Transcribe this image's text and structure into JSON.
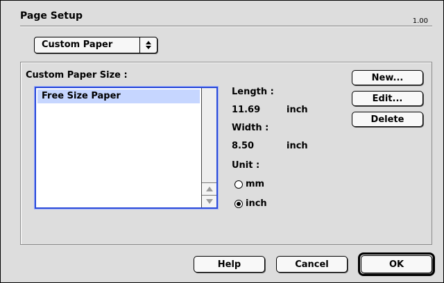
{
  "window": {
    "title": "Page Setup",
    "version": "1.00"
  },
  "popup": {
    "selected": "Custom Paper"
  },
  "custom_paper": {
    "group_label": "Custom Paper Size :",
    "list_items": [
      "Free Size Paper"
    ],
    "length_label": "Length :",
    "length_value": "11.69",
    "length_unit": "inch",
    "width_label": "Width :",
    "width_value": "8.50",
    "width_unit": "inch",
    "unit_label": "Unit :",
    "unit_options": [
      {
        "label": "mm",
        "checked": false
      },
      {
        "label": "inch",
        "checked": true
      }
    ]
  },
  "side_buttons": {
    "new": "New...",
    "edit": "Edit...",
    "delete": "Delete"
  },
  "footer_buttons": {
    "help": "Help",
    "cancel": "Cancel",
    "ok": "OK"
  }
}
